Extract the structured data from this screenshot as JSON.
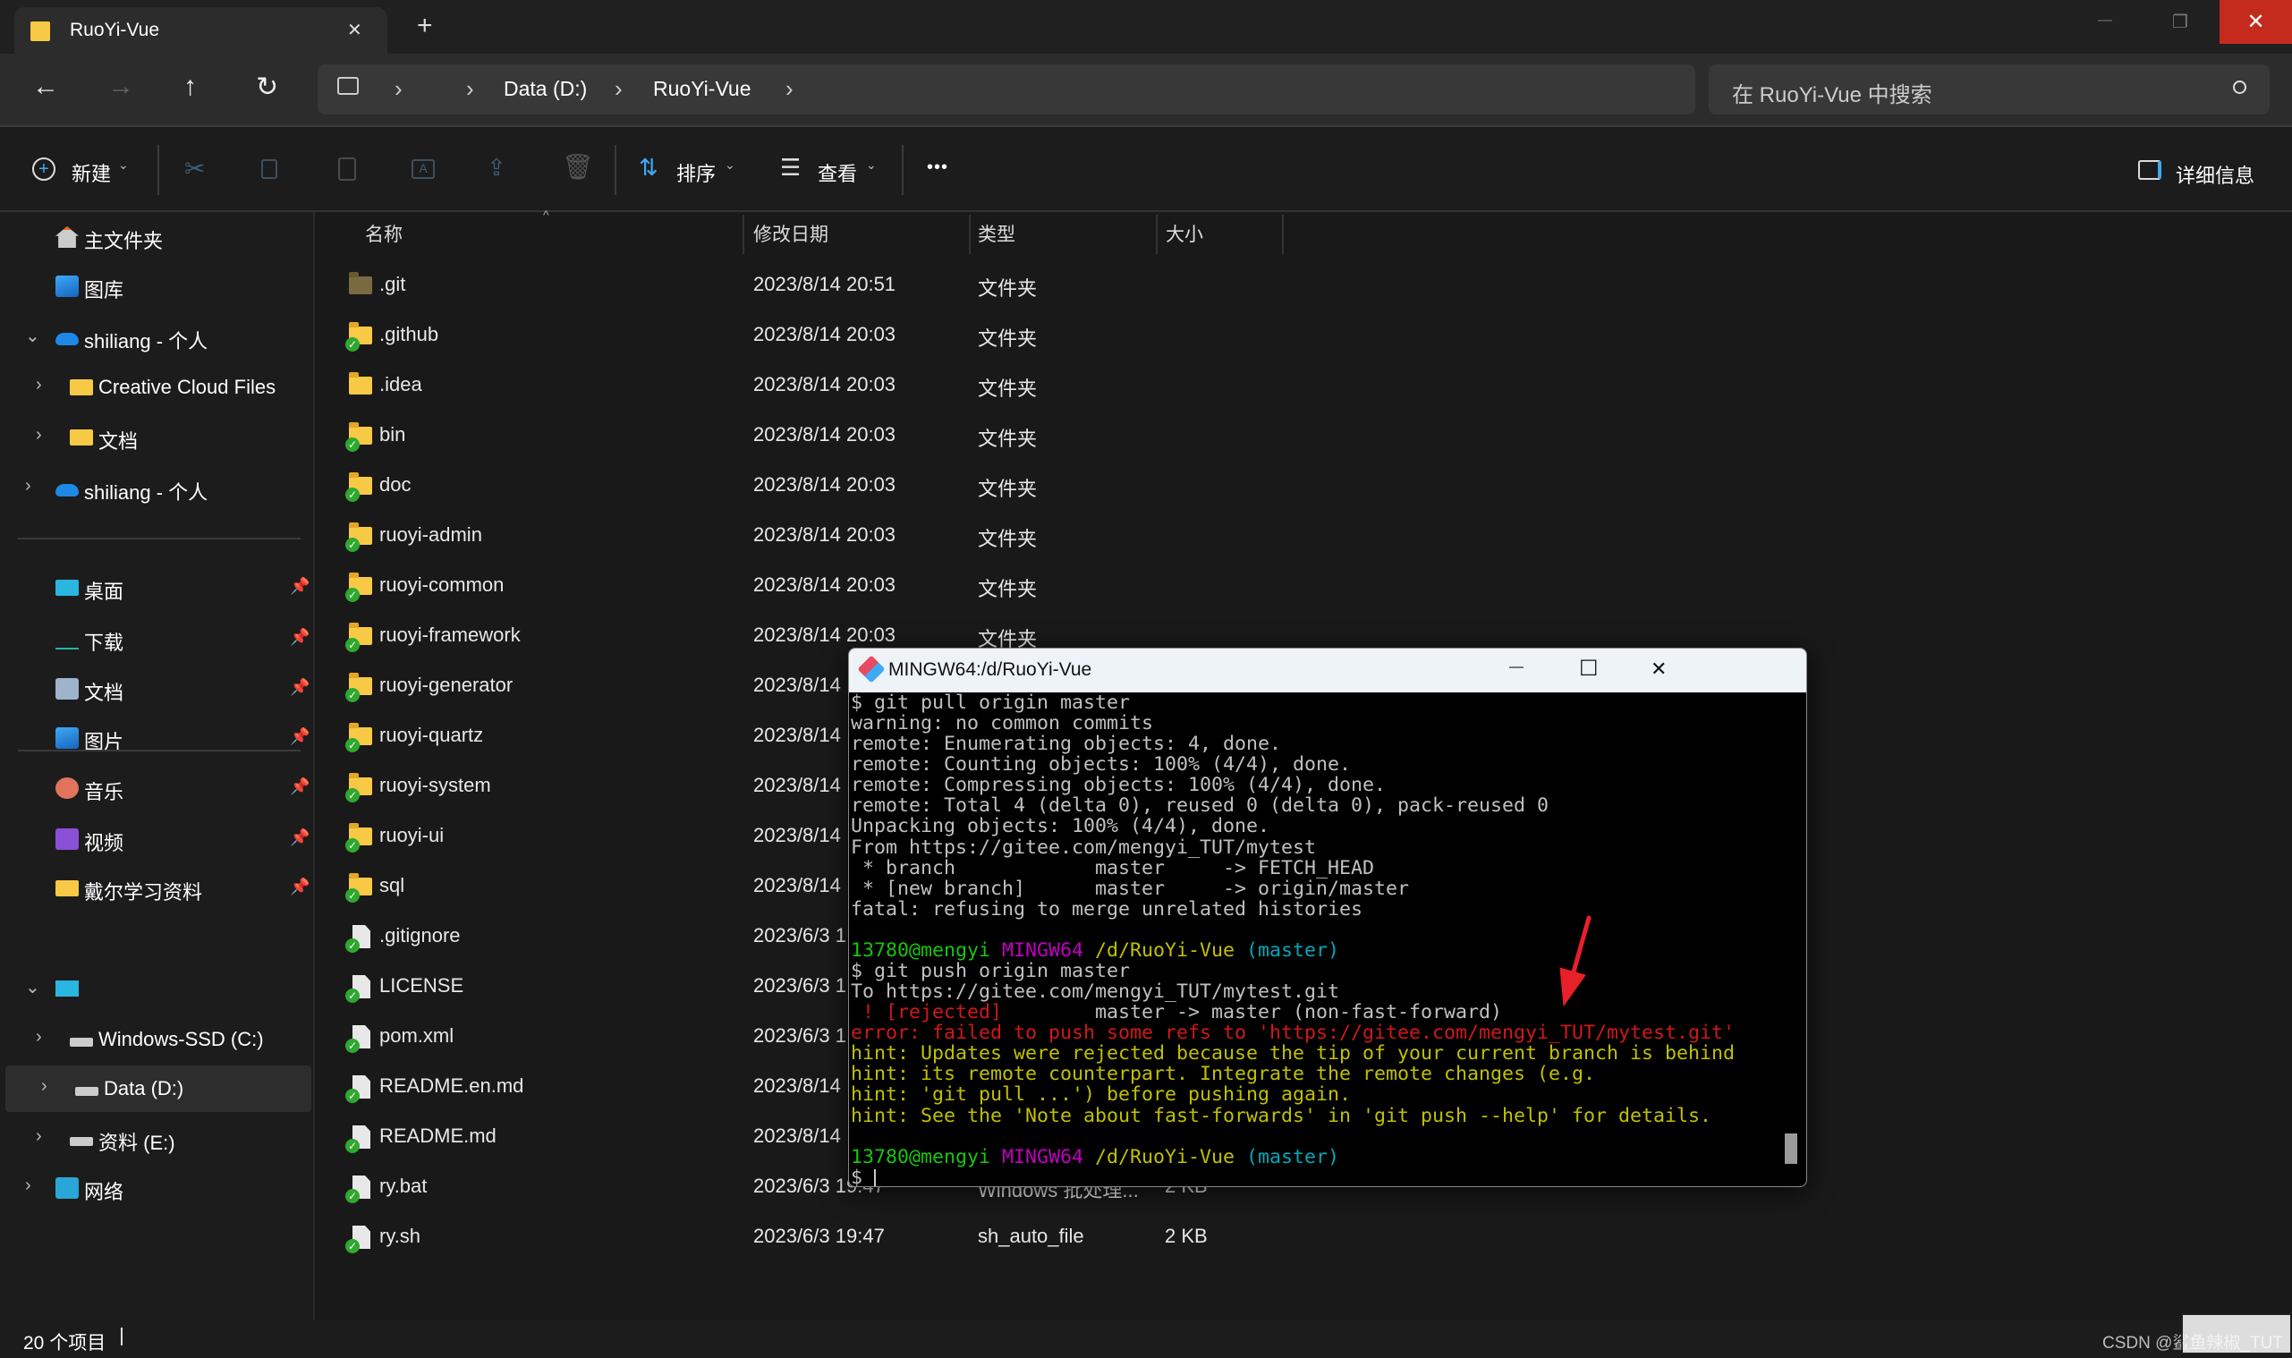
{
  "tab": {
    "title": "RuoYi-Vue",
    "close": "✕",
    "new_tab": "+"
  },
  "window_controls": {
    "minimize": "—",
    "restore": "❐",
    "close": "✕",
    "close_color": "#c42b1c"
  },
  "nav": {
    "back": "←",
    "forward": "→",
    "up": "↑",
    "refresh": "↻"
  },
  "address": {
    "crumbs": [
      "Data (D:)",
      "RuoYi-Vue"
    ],
    "separator": "›"
  },
  "search": {
    "placeholder": "在 RuoYi-Vue 中搜索"
  },
  "commands": {
    "new": "新建",
    "sort": "排序",
    "view": "查看",
    "more": "•••",
    "details": "详细信息"
  },
  "sidebar": {
    "items": [
      {
        "label": "主文件夹",
        "icon": "home-icon"
      },
      {
        "label": "图库",
        "icon": "gallery-icon"
      },
      {
        "label": "shiliang - 个人",
        "icon": "onedrive-icon",
        "expanded": true
      },
      {
        "label": "Creative Cloud Files",
        "icon": "folder-icon"
      },
      {
        "label": "文档",
        "icon": "folder-icon"
      },
      {
        "label": "shiliang - 个人",
        "icon": "onedrive-icon"
      },
      {
        "label": "桌面",
        "icon": "desktop-icon",
        "pinned": true
      },
      {
        "label": "下载",
        "icon": "download-icon",
        "pinned": true
      },
      {
        "label": "文档",
        "icon": "documents-icon",
        "pinned": true
      },
      {
        "label": "图片",
        "icon": "pictures-icon",
        "pinned": true
      },
      {
        "label": "音乐",
        "icon": "music-icon",
        "pinned": true
      },
      {
        "label": "视频",
        "icon": "video-icon",
        "pinned": true
      },
      {
        "label": "戴尔学习资料",
        "icon": "folder-icon",
        "pinned": true
      },
      {
        "label": "",
        "icon": "this-pc-icon",
        "expanded": true
      },
      {
        "label": "Windows-SSD (C:)",
        "icon": "drive-icon"
      },
      {
        "label": "Data (D:)",
        "icon": "drive-icon",
        "selected": true
      },
      {
        "label": "资料 (E:)",
        "icon": "drive-icon"
      },
      {
        "label": "网络",
        "icon": "network-icon"
      }
    ]
  },
  "columns": {
    "name": "名称",
    "date": "修改日期",
    "type": "类型",
    "size": "大小"
  },
  "files": [
    {
      "name": ".git",
      "date": "2023/8/14 20:51",
      "type": "文件夹",
      "size": "",
      "kind": "folder-dark"
    },
    {
      "name": ".github",
      "date": "2023/8/14 20:03",
      "type": "文件夹",
      "size": "",
      "kind": "folder-synced"
    },
    {
      "name": ".idea",
      "date": "2023/8/14 20:03",
      "type": "文件夹",
      "size": "",
      "kind": "folder"
    },
    {
      "name": "bin",
      "date": "2023/8/14 20:03",
      "type": "文件夹",
      "size": "",
      "kind": "folder-synced"
    },
    {
      "name": "doc",
      "date": "2023/8/14 20:03",
      "type": "文件夹",
      "size": "",
      "kind": "folder-synced"
    },
    {
      "name": "ruoyi-admin",
      "date": "2023/8/14 20:03",
      "type": "文件夹",
      "size": "",
      "kind": "folder-synced"
    },
    {
      "name": "ruoyi-common",
      "date": "2023/8/14 20:03",
      "type": "文件夹",
      "size": "",
      "kind": "folder-synced"
    },
    {
      "name": "ruoyi-framework",
      "date": "2023/8/14 20:03",
      "type": "文件夹",
      "size": "",
      "kind": "folder-synced"
    },
    {
      "name": "ruoyi-generator",
      "date": "2023/8/14",
      "type": "",
      "size": "",
      "kind": "folder-synced"
    },
    {
      "name": "ruoyi-quartz",
      "date": "2023/8/14",
      "type": "",
      "size": "",
      "kind": "folder-synced"
    },
    {
      "name": "ruoyi-system",
      "date": "2023/8/14",
      "type": "",
      "size": "",
      "kind": "folder-synced"
    },
    {
      "name": "ruoyi-ui",
      "date": "2023/8/14",
      "type": "",
      "size": "",
      "kind": "folder-synced"
    },
    {
      "name": "sql",
      "date": "2023/8/14",
      "type": "",
      "size": "",
      "kind": "folder-synced"
    },
    {
      "name": ".gitignore",
      "date": "2023/6/3 1",
      "type": "",
      "size": "",
      "kind": "file-synced"
    },
    {
      "name": "LICENSE",
      "date": "2023/6/3 1",
      "type": "",
      "size": "",
      "kind": "file-synced"
    },
    {
      "name": "pom.xml",
      "date": "2023/6/3 1",
      "type": "",
      "size": "",
      "kind": "file-synced"
    },
    {
      "name": "README.en.md",
      "date": "2023/8/14",
      "type": "",
      "size": "",
      "kind": "file-synced"
    },
    {
      "name": "README.md",
      "date": "2023/8/14",
      "type": "",
      "size": "",
      "kind": "file-synced"
    },
    {
      "name": "ry.bat",
      "date": "2023/6/3 19:47",
      "type": "Windows 批处理...",
      "size": "2 KB",
      "kind": "file-synced"
    },
    {
      "name": "ry.sh",
      "date": "2023/6/3 19:47",
      "type": "sh_auto_file",
      "size": "2 KB",
      "kind": "file-synced"
    }
  ],
  "status": {
    "count": "20 个项目"
  },
  "watermark": "CSDN @鲨鱼辣椒_TUT",
  "terminal": {
    "title": "MINGW64:/d/RuoYi-Vue",
    "controls": {
      "minimize": "—",
      "maximize": "☐",
      "close": "✕"
    },
    "colors": {
      "default": "#c0c0c0",
      "green": "#16c60c",
      "magenta": "#c000c0",
      "yellow": "#c0c000",
      "cyan": "#00a8b8",
      "red": "#d01818"
    },
    "lines": [
      [
        {
          "t": "$ git pull origin master",
          "c": "default"
        }
      ],
      [
        {
          "t": "warning: no common commits",
          "c": "default"
        }
      ],
      [
        {
          "t": "remote: Enumerating objects: 4, done.",
          "c": "default"
        }
      ],
      [
        {
          "t": "remote: Counting objects: 100% (4/4), done.",
          "c": "default"
        }
      ],
      [
        {
          "t": "remote: Compressing objects: 100% (4/4), done.",
          "c": "default"
        }
      ],
      [
        {
          "t": "remote: Total 4 (delta 0), reused 0 (delta 0), pack-reused 0",
          "c": "default"
        }
      ],
      [
        {
          "t": "Unpacking objects: 100% (4/4), done.",
          "c": "default"
        }
      ],
      [
        {
          "t": "From https://gitee.com/mengyi_TUT/mytest",
          "c": "default"
        }
      ],
      [
        {
          "t": " * branch            master     -> FETCH_HEAD",
          "c": "default"
        }
      ],
      [
        {
          "t": " * [new branch]      master     -> origin/master",
          "c": "default"
        }
      ],
      [
        {
          "t": "fatal: refusing to merge unrelated histories",
          "c": "default"
        }
      ],
      [],
      [
        {
          "t": "13780@mengyi ",
          "c": "green"
        },
        {
          "t": "MINGW64 ",
          "c": "magenta"
        },
        {
          "t": "/d/RuoYi-Vue ",
          "c": "yellow"
        },
        {
          "t": "(master)",
          "c": "cyan"
        }
      ],
      [
        {
          "t": "$ git push origin master",
          "c": "default"
        }
      ],
      [
        {
          "t": "To https://gitee.com/mengyi_TUT/mytest.git",
          "c": "default"
        }
      ],
      [
        {
          "t": " ! [rejected]",
          "c": "red"
        },
        {
          "t": "        master -> master (non-fast-forward)",
          "c": "default"
        }
      ],
      [
        {
          "t": "error: failed to push some refs to 'https://gitee.com/mengyi_TUT/mytest.git'",
          "c": "red"
        }
      ],
      [
        {
          "t": "hint: Updates were rejected because the tip of your current branch is behind",
          "c": "yellow"
        }
      ],
      [
        {
          "t": "hint: its remote counterpart. Integrate the remote changes (e.g.",
          "c": "yellow"
        }
      ],
      [
        {
          "t": "hint: 'git pull ...') before pushing again.",
          "c": "yellow"
        }
      ],
      [
        {
          "t": "hint: See the 'Note about fast-forwards' in 'git push --help' for details.",
          "c": "yellow"
        }
      ],
      [],
      [
        {
          "t": "13780@mengyi ",
          "c": "green"
        },
        {
          "t": "MINGW64 ",
          "c": "magenta"
        },
        {
          "t": "/d/RuoYi-Vue ",
          "c": "yellow"
        },
        {
          "t": "(master)",
          "c": "cyan"
        }
      ],
      [
        {
          "t": "$ ",
          "c": "default"
        }
      ]
    ]
  },
  "annotation": {
    "arrow_color": "#e8202a"
  }
}
